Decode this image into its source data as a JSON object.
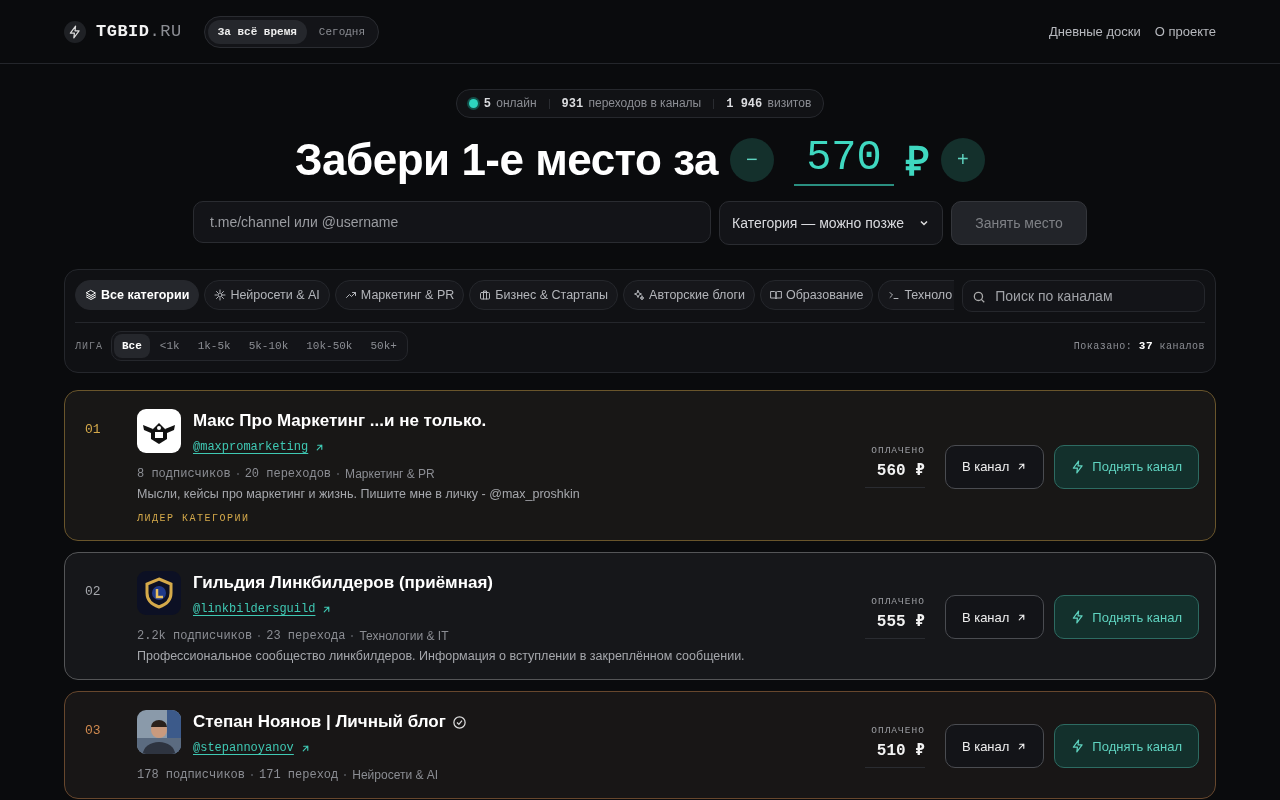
{
  "header": {
    "logo": "TGBID",
    "logo_suffix": ".RU",
    "periods": [
      {
        "label": "За всё время",
        "selected": true
      },
      {
        "label": "Сегодня",
        "selected": false
      }
    ],
    "nav": [
      "Дневные доски",
      "О проекте"
    ]
  },
  "stats": [
    {
      "value": "5",
      "label": "онлайн",
      "kind": "online"
    },
    {
      "value": "931",
      "label": "переходов в каналы",
      "kind": "plain"
    },
    {
      "value": "1 946",
      "label": "визитов",
      "kind": "plain"
    }
  ],
  "hero": {
    "title": "Забери 1-е место за",
    "price": "570",
    "currency": "₽",
    "minus": "−",
    "plus": "+"
  },
  "form": {
    "placeholder": "t.me/channel или @username",
    "category": "Категория — можно позже",
    "submit": "Занять место",
    "submit_disabled": true
  },
  "categories": [
    {
      "label": "Все категории",
      "selected": true
    },
    {
      "label": "Нейросети & AI",
      "selected": false
    },
    {
      "label": "Маркетинг & PR",
      "selected": false
    },
    {
      "label": "Бизнес & Стартапы",
      "selected": false
    },
    {
      "label": "Авторские блоги",
      "selected": false
    },
    {
      "label": "Образование",
      "selected": false
    },
    {
      "label": "Техноло",
      "selected": false
    }
  ],
  "search": {
    "placeholder": "Поиск по каналам"
  },
  "league": {
    "label": "ЛИГА",
    "options": [
      {
        "label": "Все",
        "selected": true
      },
      {
        "label": "<1k",
        "selected": false
      },
      {
        "label": "1k-5k",
        "selected": false
      },
      {
        "label": "5k-10k",
        "selected": false
      },
      {
        "label": "10k-50k",
        "selected": false
      },
      {
        "label": "50k+",
        "selected": false
      }
    ]
  },
  "shown": {
    "label": "Показано:",
    "count": "37",
    "unit": "каналов"
  },
  "channels": [
    {
      "rank": "01",
      "color": "#d4a94a",
      "avatar": {
        "kind": "logo-light"
      },
      "name": "Макс Про Маркетинг ...и не только.",
      "verified": false,
      "handle": "@maxpromarketing",
      "stats": [
        "8 подписчиков",
        "20 переходов"
      ],
      "category": "Маркетинг & PR",
      "description": "Мысли, кейсы про маркетинг и жизнь. Пишите мне в личку - @max_proshkin",
      "badge": "ЛИДЕР КАТЕГОРИИ",
      "paid_label": "ОПЛАЧЕНО",
      "paid": "560 ₽",
      "open": "В канал",
      "boost": "Поднять канал"
    },
    {
      "rank": "02",
      "color": "#a5a7ac",
      "avatar": {
        "kind": "logo-dark"
      },
      "name": "Гильдия Линкбилдеров (приёмная)",
      "verified": false,
      "handle": "@linkbildersguild",
      "stats": [
        "2.2k подписчиков",
        "23 перехода"
      ],
      "category": "Технологии & IT",
      "description": "Профессиональное сообщество линкбилдеров. Информация о вступлении в закреплённом сообщении.",
      "paid_label": "ОПЛАЧЕНО",
      "paid": "555 ₽",
      "open": "В канал",
      "boost": "Поднять канал"
    },
    {
      "rank": "03",
      "color": "#d08a4f",
      "avatar": {
        "kind": "picture"
      },
      "name": "Степан Ноянов | Личный блог",
      "verified": true,
      "handle": "@stepannoyanov",
      "stats": [
        "178 подписчиков",
        "171 переход"
      ],
      "category": "Нейросети & AI",
      "paid_label": "ОПЛАЧЕНО",
      "paid": "510 ₽",
      "open": "В канал",
      "boost": "Поднять канал"
    }
  ]
}
